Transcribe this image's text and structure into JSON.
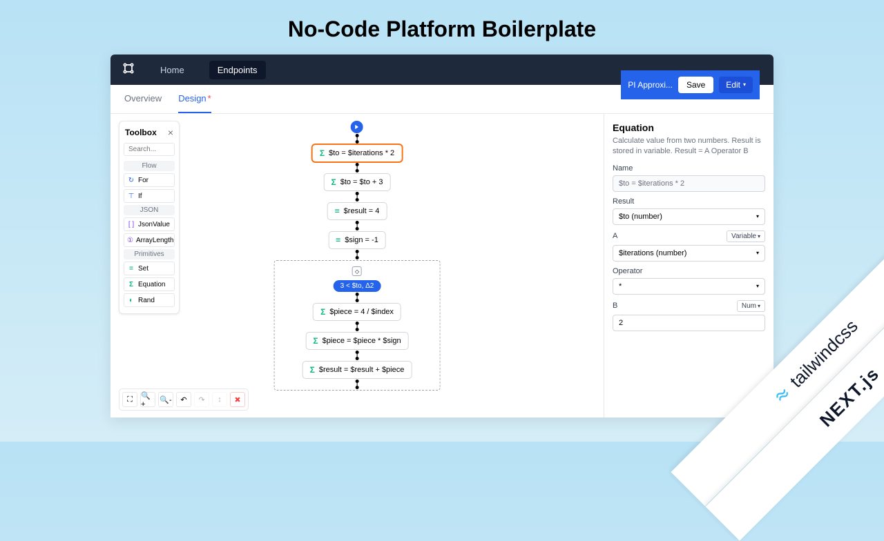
{
  "page_title": "No-Code Platform Boilerplate",
  "nav": {
    "home": "Home",
    "endpoints": "Endpoints"
  },
  "tabs": {
    "overview": "Overview",
    "design": "Design"
  },
  "toolbox": {
    "title": "Toolbox",
    "search_placeholder": "Search...",
    "sections": [
      {
        "label": "Flow",
        "items": [
          {
            "icon": "↻",
            "label": "For",
            "color": "#2563eb"
          },
          {
            "icon": "⊤",
            "label": "If",
            "color": "#2563eb"
          }
        ]
      },
      {
        "label": "JSON",
        "items": [
          {
            "icon": "[ ]",
            "label": "JsonValue",
            "color": "#7c3aed"
          },
          {
            "icon": "①",
            "label": "ArrayLength",
            "color": "#7c3aed"
          }
        ]
      },
      {
        "label": "Primitives",
        "items": [
          {
            "icon": "=",
            "label": "Set",
            "color": "#10b981"
          },
          {
            "icon": "Σ",
            "label": "Equation",
            "color": "#10b981"
          },
          {
            "icon": "◐",
            "label": "Rand",
            "color": "#10b981"
          }
        ]
      }
    ]
  },
  "flow": {
    "nodes": [
      {
        "icon": "Σ",
        "label": "$to = $iterations * 2",
        "selected": true
      },
      {
        "icon": "Σ",
        "label": "$to = $to + 3"
      },
      {
        "icon": "=",
        "label": "$result = 4"
      },
      {
        "icon": "=",
        "label": "$sign = -1"
      }
    ],
    "loop_badge": "3 < $to, Δ2",
    "loop_nodes": [
      {
        "icon": "Σ",
        "label": "$piece = 4 / $index"
      },
      {
        "icon": "Σ",
        "label": "$piece = $piece * $sign"
      },
      {
        "icon": "Σ",
        "label": "$result = $result + $piece"
      }
    ]
  },
  "props": {
    "header_title": "PI Approxi...",
    "save": "Save",
    "edit": "Edit",
    "panel_title": "Equation",
    "description": "Calculate value from two numbers. Result is stored in variable.\nResult = A Operator B",
    "fields": {
      "name_label": "Name",
      "name_value": "$to = $iterations * 2",
      "result_label": "Result",
      "result_value": "$to (number)",
      "a_label": "A",
      "a_type": "Variable",
      "a_value": "$iterations (number)",
      "operator_label": "Operator",
      "operator_value": "*",
      "b_label": "B",
      "b_type": "Num",
      "b_value": "2"
    }
  },
  "ribbons": {
    "tailwind": "tailwindcss",
    "next": "NEXT.js"
  }
}
